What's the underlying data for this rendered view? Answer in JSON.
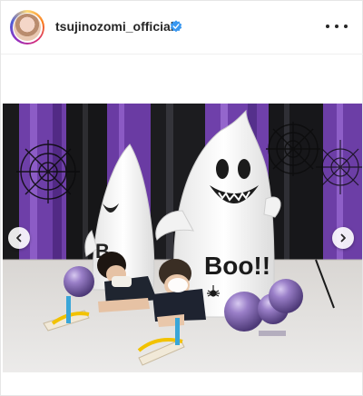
{
  "post": {
    "username": "tsujinozomi_official",
    "verified": true,
    "verified_color": "#3897f0"
  },
  "icons": {
    "verified": "verified-badge-icon",
    "more": "more-options-icon",
    "prev": "chevron-left-icon",
    "next": "chevron-right-icon"
  },
  "photo": {
    "ghost_text": "Boo!!",
    "ghost_text_left": "B"
  }
}
